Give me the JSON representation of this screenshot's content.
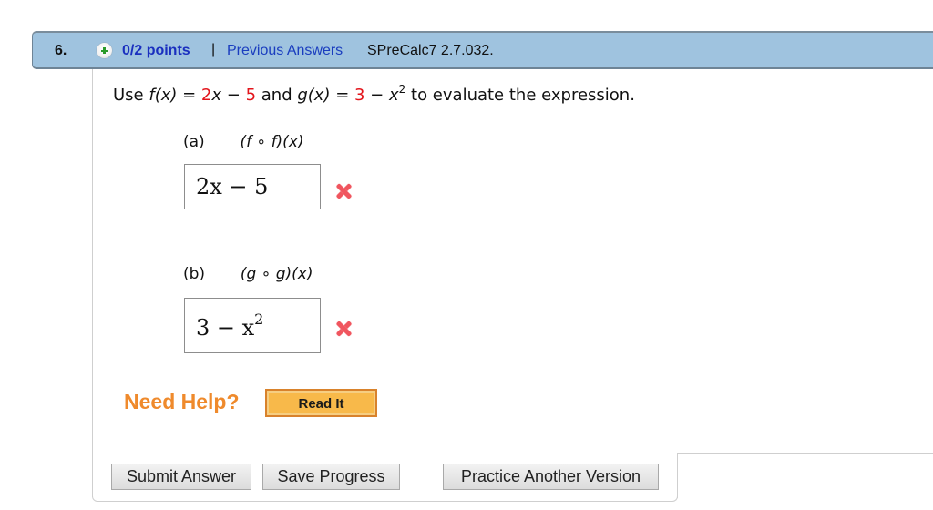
{
  "question": {
    "number": "6.",
    "points": "0/2 points",
    "separator": "|",
    "previous_answers_link": "Previous Answers",
    "problem_code": "SPreCalc7 2.7.032."
  },
  "prompt": {
    "prefix": "Use ",
    "f_name": "f(x) = ",
    "f_coef": "2",
    "f_var": "x",
    "f_minus": " − ",
    "f_const": "5",
    "and": " and ",
    "g_name": "g(x) = ",
    "g_const": "3",
    "g_minus": " − ",
    "g_var": "x",
    "g_exp": "2",
    "suffix": " to evaluate the expression."
  },
  "parts": [
    {
      "label": "(a)",
      "expression": "(f ∘ f)(x)",
      "answer_main": "2x − 5",
      "answer_exp": "",
      "status": "incorrect"
    },
    {
      "label": "(b)",
      "expression": "(g ∘ g)(x)",
      "answer_main": "3 − x",
      "answer_exp": "2",
      "status": "incorrect"
    }
  ],
  "help": {
    "label": "Need Help?",
    "read_it": "Read It"
  },
  "buttons": {
    "submit": "Submit Answer",
    "save": "Save Progress",
    "practice": "Practice Another Version"
  },
  "colors": {
    "header_bg": "#9fc3df",
    "points_text": "#1a2fbf",
    "highlight_red": "#e3141b",
    "incorrect_icon": "#f0555e",
    "help_orange": "#ef8a2c"
  }
}
